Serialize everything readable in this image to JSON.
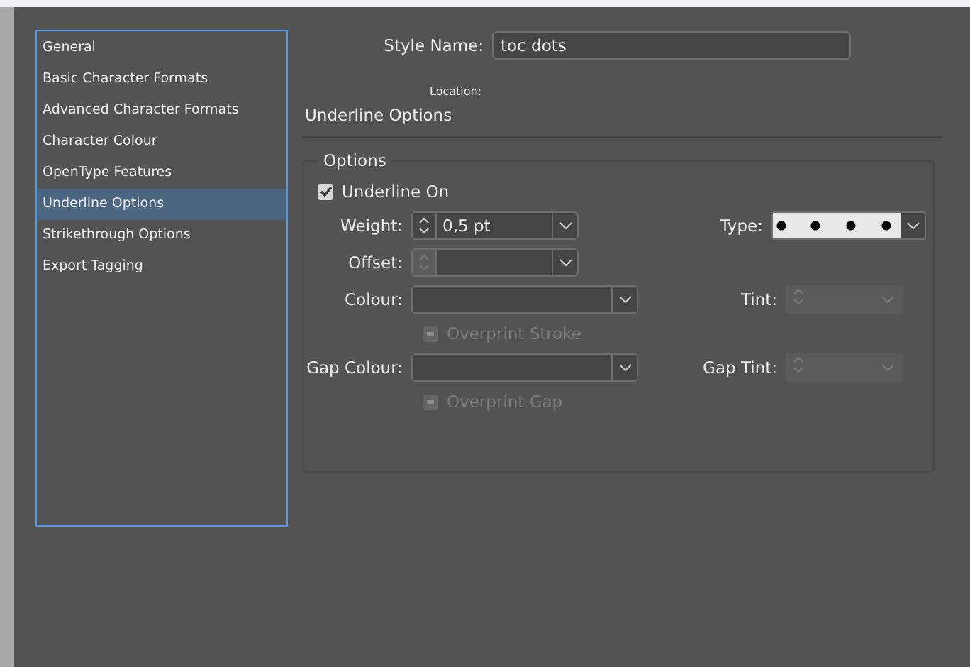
{
  "sidebar": {
    "items": [
      {
        "label": "General",
        "selected": false
      },
      {
        "label": "Basic Character Formats",
        "selected": false
      },
      {
        "label": "Advanced Character Formats",
        "selected": false
      },
      {
        "label": "Character Colour",
        "selected": false
      },
      {
        "label": "OpenType Features",
        "selected": false
      },
      {
        "label": "Underline Options",
        "selected": true
      },
      {
        "label": "Strikethrough Options",
        "selected": false
      },
      {
        "label": "Export Tagging",
        "selected": false
      }
    ]
  },
  "style_name": {
    "label": "Style Name:",
    "value": "toc dots"
  },
  "location": {
    "label": "Location:"
  },
  "section_title": "Underline Options",
  "options": {
    "legend": "Options",
    "underline_on": {
      "label": "Underline On",
      "checked": true
    },
    "weight": {
      "label": "Weight:",
      "value": "0,5 pt",
      "disabled": false
    },
    "type": {
      "label": "Type:",
      "kind": "dotted"
    },
    "offset": {
      "label": "Offset:",
      "disabled": true
    },
    "colour": {
      "label": "Colour:"
    },
    "tint": {
      "label": "Tint:",
      "disabled": true
    },
    "overprint_stroke": {
      "label": "Overprint Stroke",
      "disabled": true
    },
    "gap_colour": {
      "label": "Gap Colour:"
    },
    "gap_tint": {
      "label": "Gap Tint:",
      "disabled": true
    },
    "overprint_gap": {
      "label": "Overprint Gap",
      "disabled": true
    }
  }
}
